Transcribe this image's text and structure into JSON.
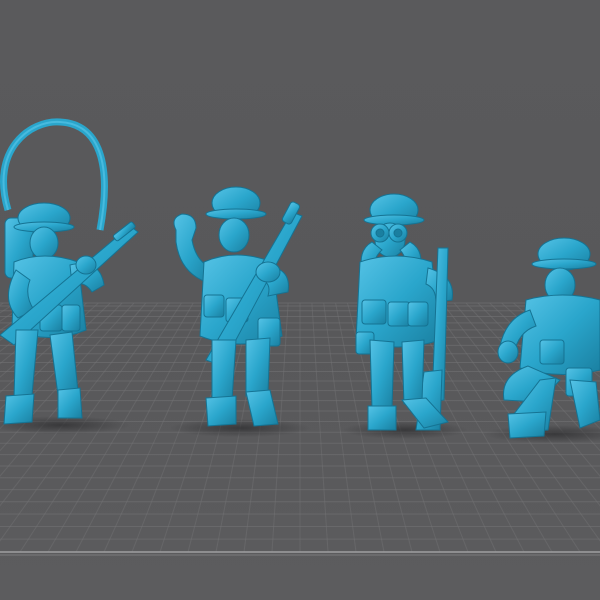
{
  "viewport": {
    "background_color": "#59595b",
    "grid_color": "#747476",
    "grid_edge_color": "#9a9a9c",
    "model_color": "#2aa6cc",
    "model_shadow_color": "#1a7fa0",
    "model_highlight_color": "#56c3e6"
  },
  "models": [
    {
      "name": "soldier-aiming-rifle-with-radio-antenna",
      "pose": "standing"
    },
    {
      "name": "soldier-raising-fist-with-rifle",
      "pose": "standing"
    },
    {
      "name": "soldier-with-binoculars-and-rifle",
      "pose": "standing"
    },
    {
      "name": "soldier-kneeling",
      "pose": "kneeling"
    }
  ]
}
